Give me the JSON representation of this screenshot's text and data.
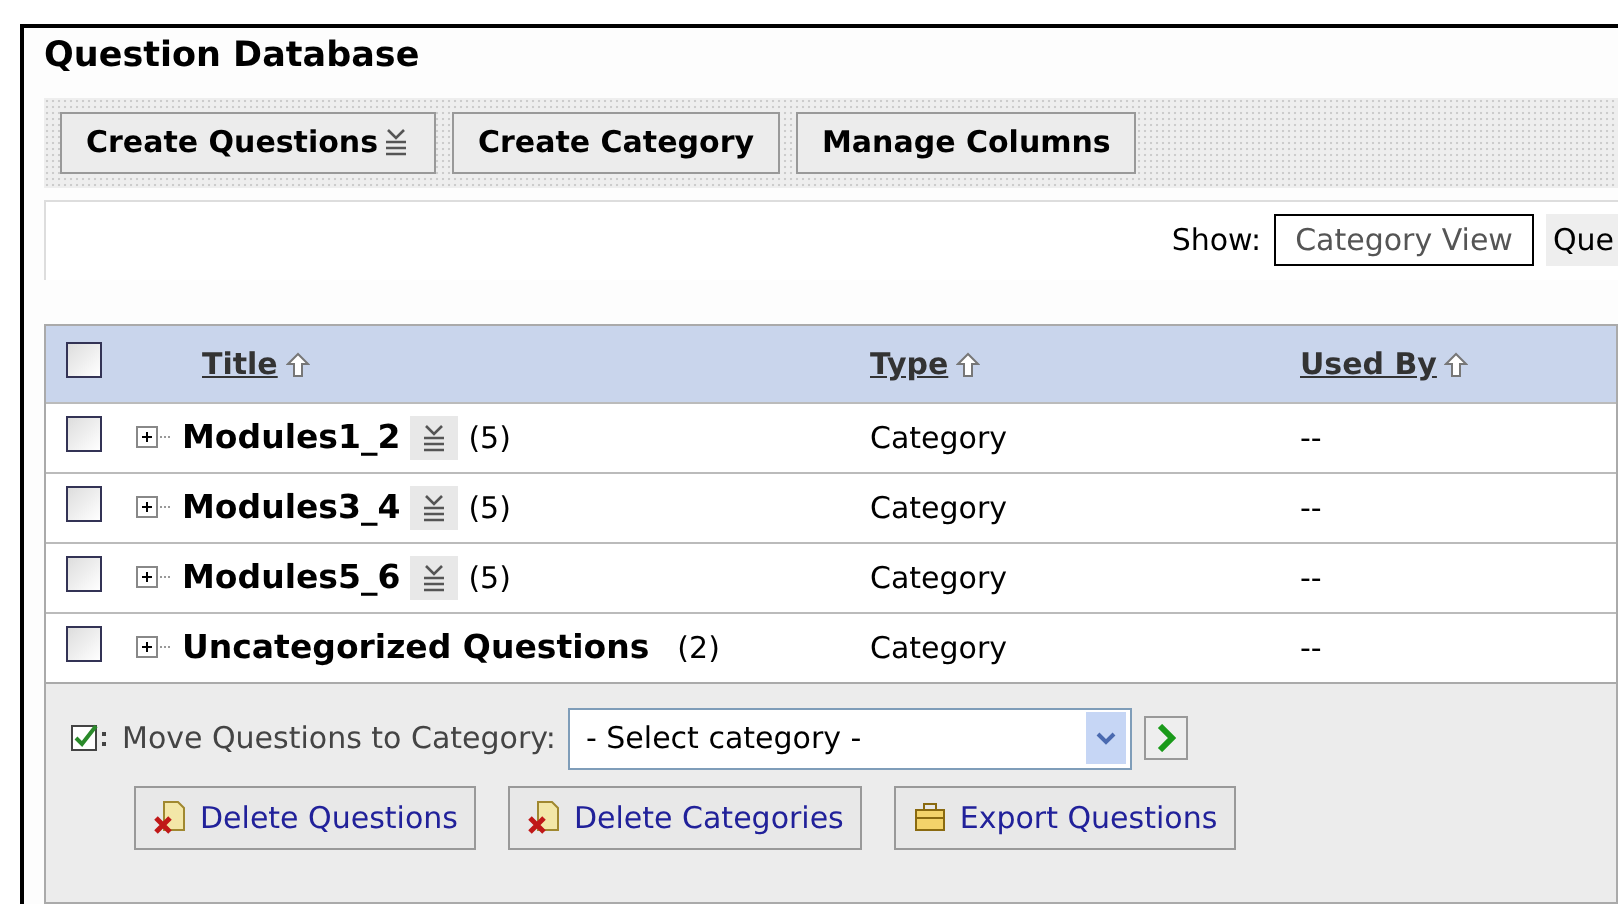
{
  "title": "Question Database",
  "toolbar": [
    {
      "label": "Create Questions",
      "kind": "menu"
    },
    {
      "label": "Create Category",
      "kind": "plain"
    },
    {
      "label": "Manage Columns",
      "kind": "plain"
    }
  ],
  "show": {
    "label": "Show:",
    "views": [
      {
        "label": "Category View",
        "selected": true
      },
      {
        "label": "Que",
        "selected": false
      }
    ]
  },
  "table": {
    "header_checked": false,
    "columns": [
      "Title",
      "Type",
      "Used By"
    ],
    "rows": [
      {
        "title": "Modules1_2",
        "menu": true,
        "count": "(5)",
        "type": "Category",
        "used_by": "--",
        "checked": false
      },
      {
        "title": "Modules3_4",
        "menu": true,
        "count": "(5)",
        "type": "Category",
        "used_by": "--",
        "checked": false
      },
      {
        "title": "Modules5_6",
        "menu": true,
        "count": "(5)",
        "type": "Category",
        "used_by": "--",
        "checked": false
      },
      {
        "title": "Uncategorized Questions",
        "menu": false,
        "count": "(2)",
        "type": "Category",
        "used_by": "--",
        "checked": false
      }
    ]
  },
  "move": {
    "label": "Move Questions to Category:",
    "select": "- Select category -"
  },
  "actions": [
    {
      "label": "Delete Questions",
      "kind": "delete"
    },
    {
      "label": "Delete Categories",
      "kind": "delete"
    },
    {
      "label": "Export Questions",
      "kind": "export"
    }
  ]
}
